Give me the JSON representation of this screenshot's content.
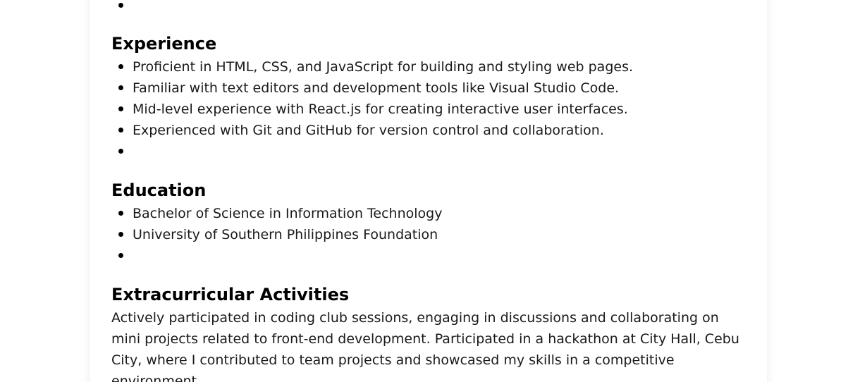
{
  "sections": {
    "experience": {
      "heading": "Experience",
      "items": [
        "Proficient in HTML, CSS, and JavaScript for building and styling web pages.",
        "Familiar with text editors and development tools like Visual Studio Code.",
        "Mid-level experience with React.js for creating interactive user interfaces.",
        "Experienced with Git and GitHub for version control and collaboration.",
        ""
      ]
    },
    "education": {
      "heading": "Education",
      "items": [
        "Bachelor of Science in Information Technology",
        "University of Southern Philippines Foundation",
        ""
      ]
    },
    "extracurricular": {
      "heading": "Extracurricular Activities",
      "text": "Actively participated in coding club sessions, engaging in discussions and collaborating on mini projects related to front-end development. Participated in a hackathon at City Hall, Cebu City, where I contributed to team projects and showcased my skills in a competitive environment."
    }
  }
}
